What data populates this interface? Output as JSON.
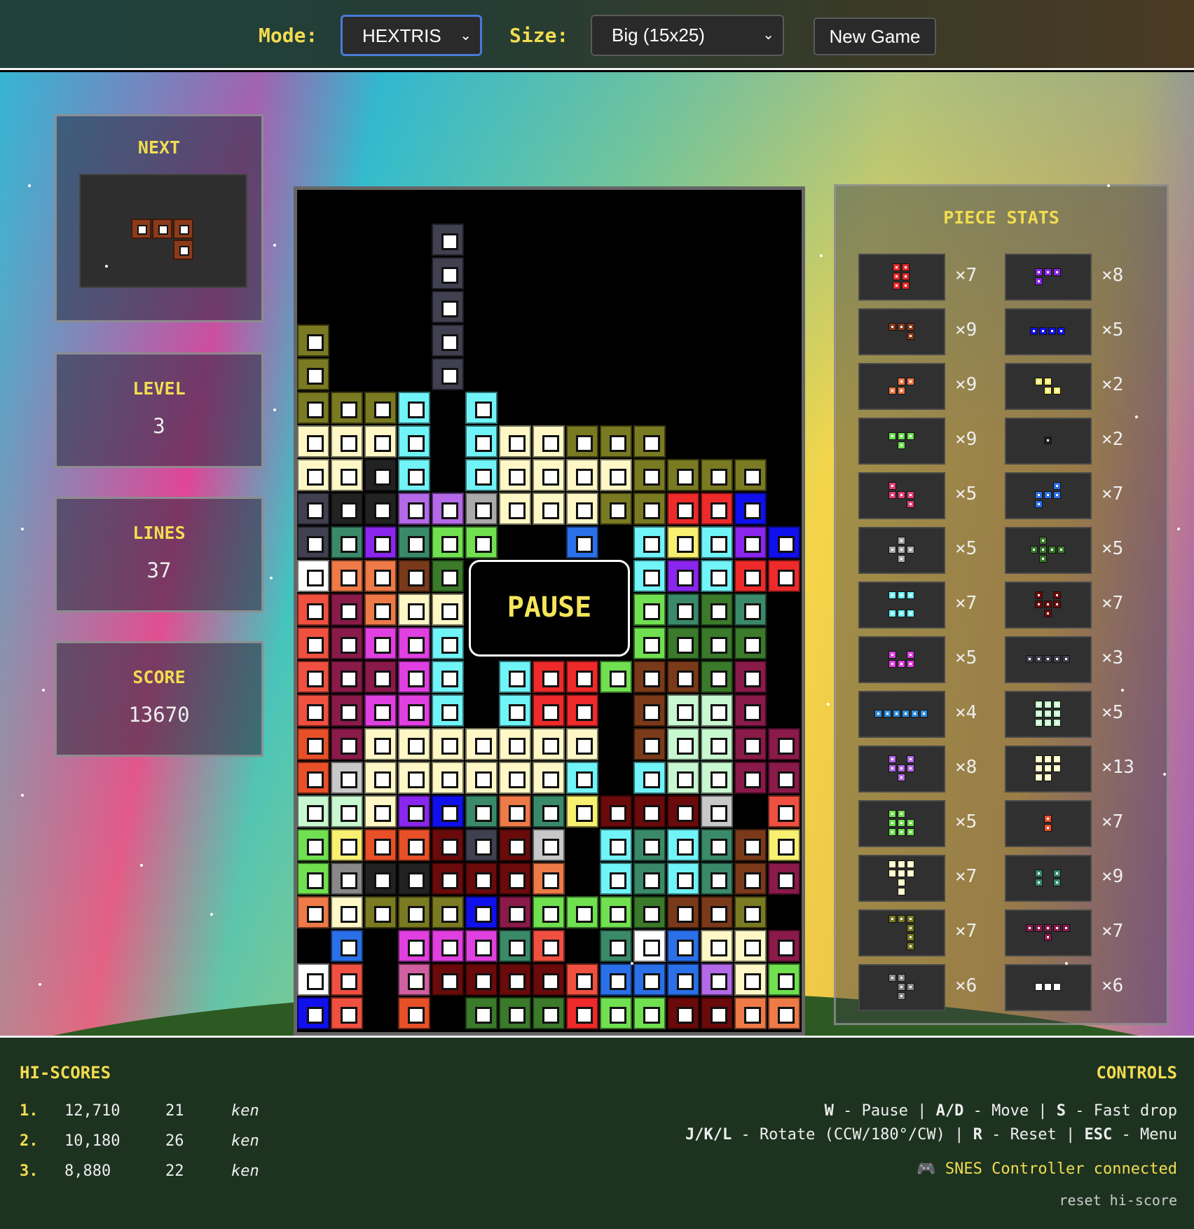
{
  "topbar": {
    "mode_label": "Mode:",
    "mode_value": "HEXTRIS",
    "size_label": "Size:",
    "size_value": "Big (15x25)",
    "new_game_label": "New Game"
  },
  "next": {
    "title": "NEXT",
    "color": "#8b3a1a",
    "cells": [
      [
        0,
        0
      ],
      [
        1,
        0
      ],
      [
        2,
        0
      ],
      [
        2,
        1
      ]
    ]
  },
  "level": {
    "title": "LEVEL",
    "value": "3"
  },
  "lines": {
    "title": "LINES",
    "value": "37"
  },
  "score": {
    "title": "SCORE",
    "value": "13670"
  },
  "board": {
    "cols": 15,
    "rows": 25,
    "paused": true,
    "pause_label": "PAUSE",
    "palette": {
      "o": "#7a7a22",
      "y": "#fff8c6",
      "c": "#70f4f8",
      "d": "#404050",
      "g": "#aaaaaa",
      "p": "#b46ae8",
      "v": "#8a26ee",
      "m": "#e040e0",
      "l": "#70e050",
      "G": "#3a7a2a",
      "T": "#3a8a6a",
      "R": "#ee2a2a",
      "B": "#1010ee",
      "b": "#2a70e8",
      "P": "#8a1a4a",
      "O": "#ee7a48",
      "r": "#e85028",
      "w": "#ffffff",
      "W": "#6a0a0a",
      "n": "#7a3a1a",
      "Y": "#f8f070",
      "s": "#c8f8d0",
      "k": "#c8c8c8",
      "h": "#222222",
      "x": "#d060a0",
      "u": "#d0d0ff",
      "z": "#f05040"
    },
    "grid": [
      "...............",
      "....d..........",
      "....d..........",
      "....d..........",
      "o...d..........",
      "o...d..........",
      "oooc.c.........",
      "yyyc.cyyooo....",
      "yyhc.cyyyyoooo.",
      "dhhppgyyyooRRB.",
      "dTvTll..b.cYcvB",
      "wOOnG.....cvcRR",
      "zPOyy.....lTGT.",
      "zPmmc.....lGGG.",
      "zPPmc.cRRlnnGP.",
      "zPmmc.cRR.nssP.",
      "rPyyyyyyy.nssPP",
      "rkyyyyyyc.cssPP",
      "ssyvBTOTYWWWk.z",
      "lYrrWdWk.cTcTnY",
      "lHhhWWWO.cTcTnP",
      "OyoooBPlllGnno.",
      ".b.mmmTz.TwbyyP",
      "wz.xWWWWzbbbpyl",
      "Bz.r.GGGRllWWOO"
    ]
  },
  "piece_stats": {
    "title": "PIECE STATS",
    "items": [
      {
        "count": "×7",
        "color": "#ee2a2a"
      },
      {
        "count": "×8",
        "color": "#8a26ee"
      },
      {
        "count": "×9",
        "color": "#8b3a1a"
      },
      {
        "count": "×5",
        "color": "#1010ee"
      },
      {
        "count": "×9",
        "color": "#ee7a48"
      },
      {
        "count": "×2",
        "color": "#f8f070"
      },
      {
        "count": "×9",
        "color": "#70e050"
      },
      {
        "count": "×2",
        "color": "#222222"
      },
      {
        "count": "×5",
        "color": "#e0407a"
      },
      {
        "count": "×7",
        "color": "#2a70e8"
      },
      {
        "count": "×5",
        "color": "#aaaaaa"
      },
      {
        "count": "×5",
        "color": "#3a7a2a"
      },
      {
        "count": "×7",
        "color": "#70f4f8"
      },
      {
        "count": "×7",
        "color": "#6a0a0a"
      },
      {
        "count": "×5",
        "color": "#e040e0"
      },
      {
        "count": "×3",
        "color": "#404050"
      },
      {
        "count": "×4",
        "color": "#3090e0"
      },
      {
        "count": "×5",
        "color": "#c8f8d0"
      },
      {
        "count": "×8",
        "color": "#b46ae8"
      },
      {
        "count": "×13",
        "color": "#fff8c6"
      },
      {
        "count": "×5",
        "color": "#70e050"
      },
      {
        "count": "×7",
        "color": "#e85028"
      },
      {
        "count": "×7",
        "color": "#fff8c6"
      },
      {
        "count": "×9",
        "color": "#3a8a6a"
      },
      {
        "count": "×7",
        "color": "#7a7a22"
      },
      {
        "count": "×7",
        "color": "#8a1a4a"
      },
      {
        "count": "×6",
        "color": "#888888"
      },
      {
        "count": "×6",
        "color": "#ffffff"
      }
    ]
  },
  "hiscores": {
    "title": "HI-SCORES",
    "entries": [
      {
        "rank": "1.",
        "score": "12,710",
        "lines": "21",
        "name": "ken"
      },
      {
        "rank": "2.",
        "score": "10,180",
        "lines": "26",
        "name": "ken"
      },
      {
        "rank": "3.",
        "score": "8,880",
        "lines": "22",
        "name": "ken"
      }
    ]
  },
  "controls": {
    "title": "CONTROLS",
    "line1": {
      "k1": "W",
      "t1": " - Pause | ",
      "k2": "A/D",
      "t2": " - Move | ",
      "k3": "S",
      "t3": " - Fast drop"
    },
    "line2": {
      "k1": "J/K/L",
      "t1": " - Rotate (CCW/180°/CW) | ",
      "k2": "R",
      "t2": " - Reset | ",
      "k3": "ESC",
      "t3": " - Menu"
    },
    "controller": "🎮 SNES Controller connected",
    "reset": "reset hi-score"
  }
}
